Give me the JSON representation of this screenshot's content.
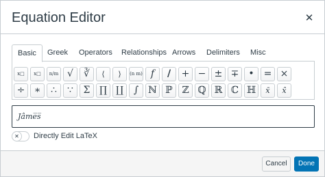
{
  "dialog": {
    "title": "Equation Editor",
    "close_label": "✕"
  },
  "tabs": [
    {
      "label": "Basic",
      "active": true
    },
    {
      "label": "Greek"
    },
    {
      "label": "Operators"
    },
    {
      "label": "Relationships"
    },
    {
      "label": "Arrows"
    },
    {
      "label": "Delimiters"
    },
    {
      "label": "Misc"
    }
  ],
  "buttons": {
    "row1": [
      "x□",
      "x□",
      "n/m",
      "√",
      "∛",
      "⟨",
      "⟩",
      "(n m)",
      "f",
      "/",
      "+",
      "−",
      "±",
      "∓",
      "•",
      "=",
      "×"
    ],
    "row2": [
      "÷",
      "∗",
      "∴",
      "∵",
      "Σ",
      "∏",
      "∐",
      "∫",
      "ℕ",
      "ℙ",
      "ℤ",
      "ℚ",
      "ℝ",
      "ℂ",
      "ℍ",
      "x̄",
      "x̂"
    ]
  },
  "equation": {
    "value": "Jâme̅s̅"
  },
  "latex_toggle": {
    "label": "Directly Edit LaTeX",
    "icon": "✕"
  },
  "footer": {
    "cancel_label": "Cancel",
    "done_label": "Done"
  },
  "colors": {
    "primary": "#0374b5",
    "border": "#c7cdd1",
    "text": "#2d3b45"
  }
}
